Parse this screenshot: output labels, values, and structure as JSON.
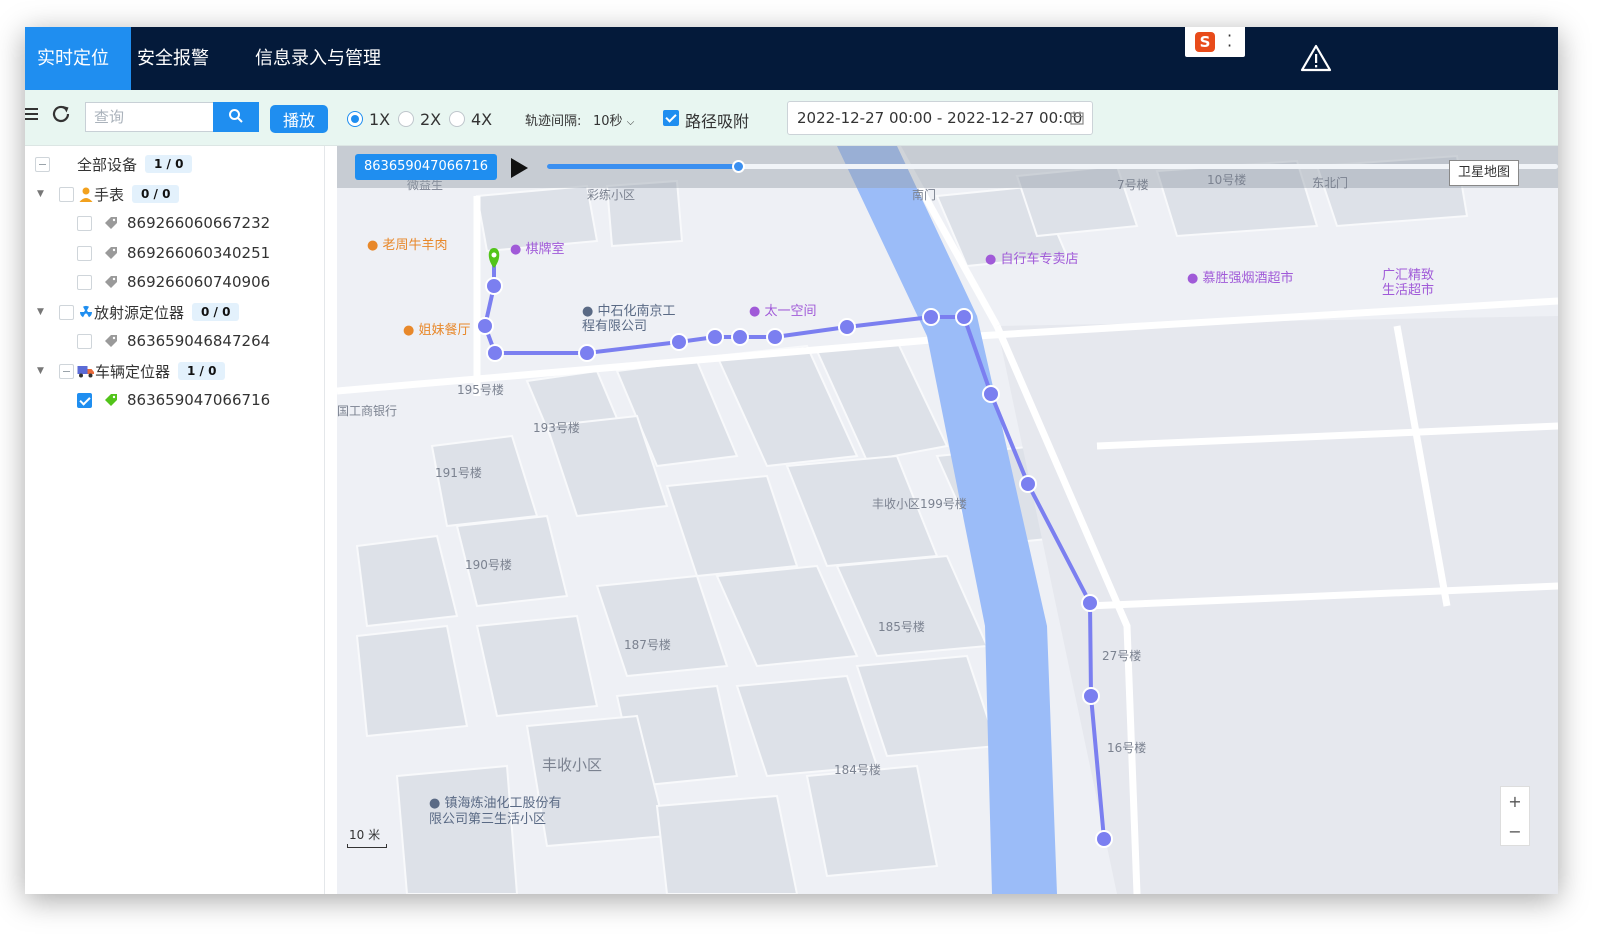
{
  "nav": {
    "tabs": [
      {
        "label": "实时定位",
        "active": true
      },
      {
        "label": "安全报警",
        "active": false
      },
      {
        "label": "信息录入与管理",
        "active": false
      }
    ]
  },
  "toolbar": {
    "search_placeholder": "查询",
    "play_label": "播放",
    "speeds": [
      {
        "label": "1X",
        "checked": true
      },
      {
        "label": "2X",
        "checked": false
      },
      {
        "label": "4X",
        "checked": false
      }
    ],
    "interval_label": "轨迹间隔:",
    "interval_value": "10秒",
    "snap_label": "路径吸附",
    "snap_checked": true,
    "date_range": "2022-12-27 00:00 - 2022-12-27 00:00"
  },
  "tree": {
    "root": {
      "label": "全部设备",
      "count": "1 / 0"
    },
    "groups": [
      {
        "label": "手表",
        "count": "0 / 0",
        "icon": "person-icon",
        "devices": [
          "869266060667232",
          "869266060340251",
          "869266060740906"
        ]
      },
      {
        "label": "放射源定位器",
        "count": "0 / 0",
        "icon": "radiation-icon",
        "devices": [
          "863659046847264"
        ]
      },
      {
        "label": "车辆定位器",
        "count": "1 / 0",
        "icon": "truck-icon",
        "devices": [
          "863659047066716"
        ]
      }
    ]
  },
  "map": {
    "device_tag": "863659047066716",
    "progress": 0.19,
    "satellite_label": "卫星地图",
    "scale": "10 米",
    "labels": {
      "area1": "彩练小区",
      "area2": "丰收小区",
      "b195": "195号楼",
      "b193": "193号楼",
      "b191": "191号楼",
      "b190": "190号楼",
      "b187": "187号楼",
      "b185": "185号楼",
      "b184": "184号楼",
      "b199": "丰收小区199号楼",
      "b27": "27号楼",
      "b16": "16号楼",
      "b7": "7号楼",
      "b10": "10号楼",
      "gate_s": "南门",
      "gate_ne": "东北门",
      "bank": "国工商银行",
      "hospital": "微益生"
    },
    "pois": {
      "beef": "老周牛羊肉",
      "chess": "棋牌室",
      "sister": "姐妹餐厅",
      "sinopec": "中石化南京工程有限公司",
      "taiyi": "太一空间",
      "bike": "自行车专卖店",
      "tobacco": "慕胜强烟酒超市",
      "guanghui": "广汇精致生活超市",
      "zhenhai": "镇海炼油化工股份有限公司第三生活小区"
    }
  },
  "colors": {
    "nav_bg": "#041a3a",
    "accent": "#1f8ef0",
    "route": "#7b7ff0",
    "river": "#9bbcf8"
  }
}
